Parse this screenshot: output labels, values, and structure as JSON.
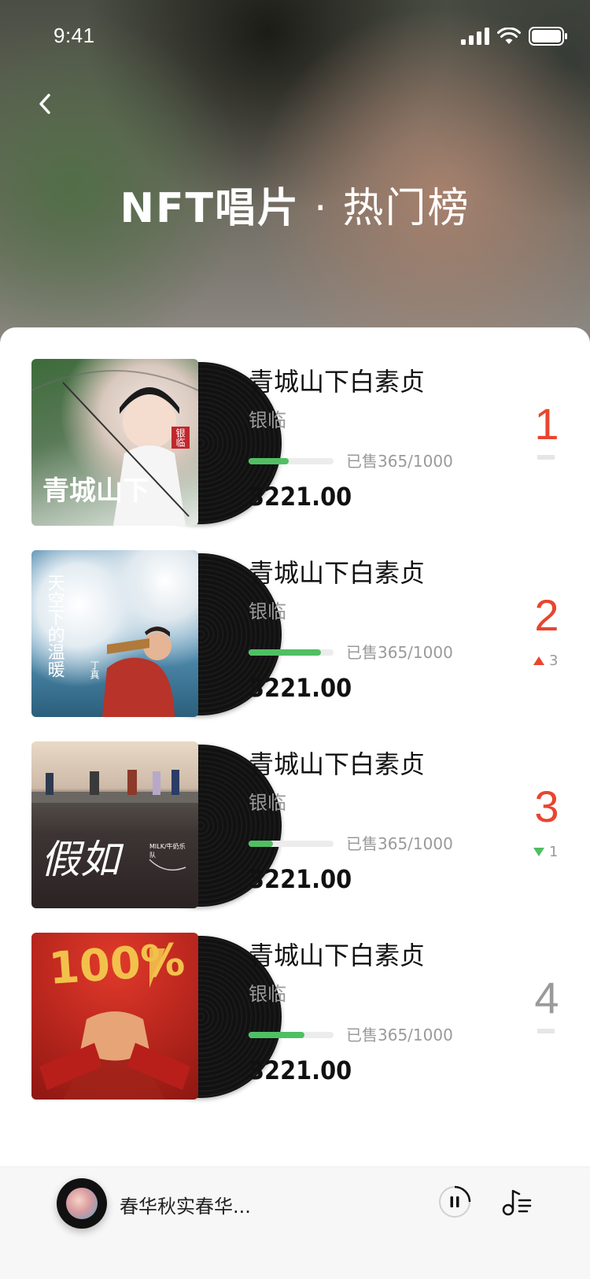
{
  "status_bar": {
    "time": "9:41"
  },
  "header": {
    "brand": "NFT唱片",
    "separator": "·",
    "subtitle": "热门榜"
  },
  "items": [
    {
      "title": "青城山下白素贞",
      "artist": "银临",
      "sold_text": "已售365/1000",
      "progress": 0.47,
      "price": "3221.00",
      "rank": "1",
      "rank_color": "#e8452f",
      "change_dir": "none",
      "change": ""
    },
    {
      "title": "青城山下白素贞",
      "artist": "银临",
      "sold_text": "已售365/1000",
      "progress": 0.85,
      "price": "3221.00",
      "rank": "2",
      "rank_color": "#e8452f",
      "change_dir": "up",
      "change": "3"
    },
    {
      "title": "青城山下白素贞",
      "artist": "银临",
      "sold_text": "已售365/1000",
      "progress": 0.29,
      "price": "3221.00",
      "rank": "3",
      "rank_color": "#e8452f",
      "change_dir": "down",
      "change": "1"
    },
    {
      "title": "青城山下白素贞",
      "artist": "银临",
      "sold_text": "已售365/1000",
      "progress": 0.66,
      "price": "3221.00",
      "rank": "4",
      "rank_color": "#9a9a9a",
      "change_dir": "none",
      "change": ""
    }
  ],
  "covers": [
    {
      "text": "青城山下",
      "label": "银临"
    },
    {
      "text": "天空下的温暖",
      "label": "丁真"
    },
    {
      "text": "假如",
      "label": "MILK/牛奶乐队"
    },
    {
      "text": "100%",
      "label": ""
    }
  ],
  "player": {
    "title": "春华秋实春华..."
  },
  "colors": {
    "accent": "#e8452f",
    "progress": "#4fbf63",
    "up": "#e8452f",
    "down": "#4fbf63"
  }
}
